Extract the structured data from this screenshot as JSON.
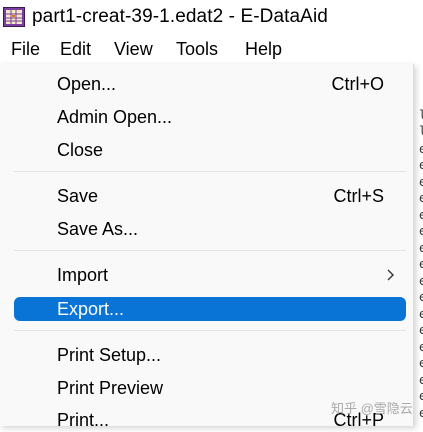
{
  "window": {
    "title": "part1-creat-39-1.edat2 - E-DataAid",
    "icon": "e-dataaid-app-icon"
  },
  "menubar": {
    "items": [
      {
        "label": "File"
      },
      {
        "label": "Edit"
      },
      {
        "label": "View"
      },
      {
        "label": "Tools"
      },
      {
        "label": "Help"
      }
    ]
  },
  "file_menu": {
    "items": [
      {
        "label": "Open...",
        "shortcut": "Ctrl+O"
      },
      {
        "label": "Admin Open..."
      },
      {
        "label": "Close"
      },
      {
        "label": "Save",
        "shortcut": "Ctrl+S"
      },
      {
        "label": "Save As..."
      },
      {
        "label": "Import",
        "submenu": true
      },
      {
        "label": "Export...",
        "highlighted": true
      },
      {
        "label": "Print Setup..."
      },
      {
        "label": "Print Preview"
      },
      {
        "label": "Print...",
        "shortcut": "Ctrl+P"
      }
    ]
  },
  "background_text": {
    "chars": [
      "l",
      "l",
      "e",
      "e",
      "e",
      "e",
      "e",
      "e",
      "e",
      "e",
      "e",
      "e",
      "e",
      "e",
      "e",
      "e",
      "e",
      "e",
      "e",
      "e",
      "e",
      "e"
    ]
  },
  "watermark": {
    "text": "知乎 @雪隐云"
  },
  "colors": {
    "highlight": "#0a73d6",
    "menu_background": "#f9f9f9"
  }
}
